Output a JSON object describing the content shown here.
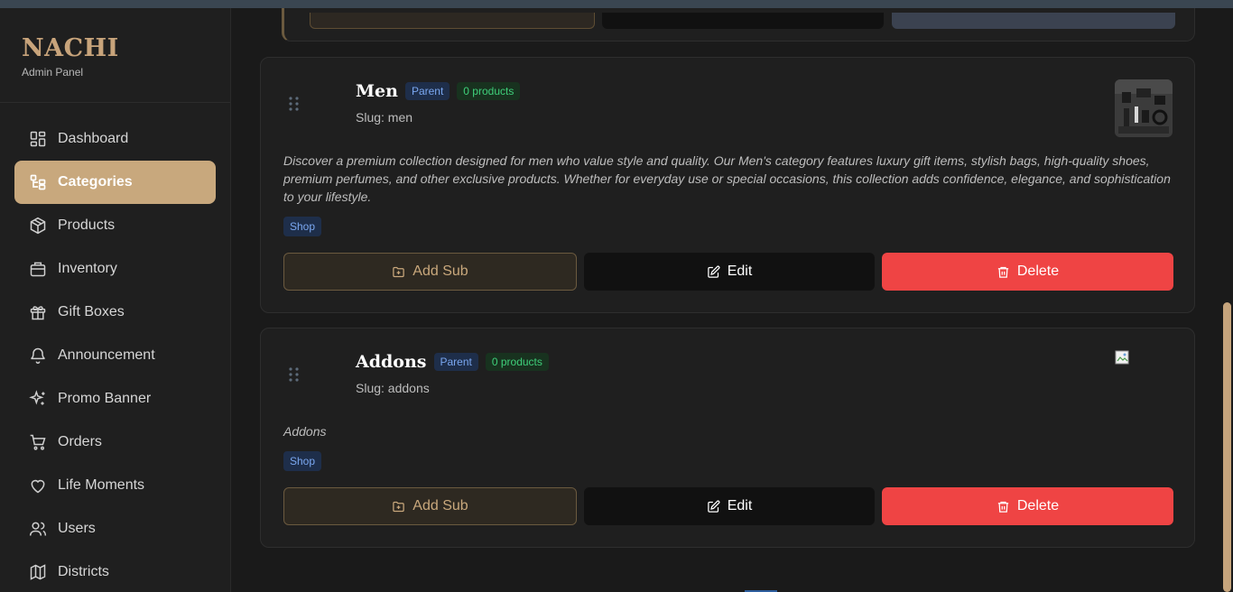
{
  "brand": {
    "title": "NACHI",
    "subtitle": "Admin Panel"
  },
  "colors": {
    "accent": "#c8a87d",
    "delete": "#ef4444",
    "parent_badge": "#7aa7f0",
    "products_badge": "#3fcf7a"
  },
  "nav": [
    {
      "label": "Dashboard",
      "icon": "dashboard-icon",
      "active": false
    },
    {
      "label": "Categories",
      "icon": "categories-icon",
      "active": true
    },
    {
      "label": "Products",
      "icon": "package-icon",
      "active": false
    },
    {
      "label": "Inventory",
      "icon": "inventory-icon",
      "active": false
    },
    {
      "label": "Gift Boxes",
      "icon": "gift-icon",
      "active": false
    },
    {
      "label": "Announcement",
      "icon": "bell-icon",
      "active": false
    },
    {
      "label": "Promo Banner",
      "icon": "sparkles-icon",
      "active": false
    },
    {
      "label": "Orders",
      "icon": "cart-icon",
      "active": false
    },
    {
      "label": "Life Moments",
      "icon": "heart-icon",
      "active": false
    },
    {
      "label": "Users",
      "icon": "users-icon",
      "active": false
    },
    {
      "label": "Districts",
      "icon": "map-icon",
      "active": false
    }
  ],
  "categories": [
    {
      "name": "Men",
      "parent_badge": "Parent",
      "products_badge": "0 products",
      "slug": "Slug: men",
      "description": "Discover a premium collection designed for men who value style and quality. Our Men's category features luxury gift items, stylish bags, high-quality shoes, premium perfumes, and other exclusive products. Whether for everyday use or special occasions, this collection adds confidence, elegance, and sophistication to your lifestyle.",
      "tag": "Shop",
      "add_sub_label": "Add Sub",
      "edit_label": "Edit",
      "delete_label": "Delete"
    },
    {
      "name": "Addons",
      "parent_badge": "Parent",
      "products_badge": "0 products",
      "slug": "Slug: addons",
      "description": "Addons",
      "tag": "Shop",
      "add_sub_label": "Add Sub",
      "edit_label": "Edit",
      "delete_label": "Delete"
    }
  ]
}
